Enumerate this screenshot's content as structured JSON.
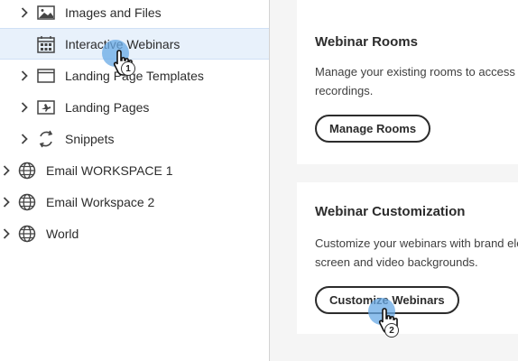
{
  "sidebar": {
    "items": [
      {
        "label": "Images and Files",
        "icon": "image-icon",
        "indent": 1,
        "expandable": true,
        "selected": false
      },
      {
        "label": "Interactive Webinars",
        "icon": "calendar-grid-icon",
        "indent": 1,
        "expandable": false,
        "selected": true
      },
      {
        "label": "Landing Page Templates",
        "icon": "template-icon",
        "indent": 1,
        "expandable": true,
        "selected": false
      },
      {
        "label": "Landing Pages",
        "icon": "landing-page-icon",
        "indent": 1,
        "expandable": true,
        "selected": false
      },
      {
        "label": "Snippets",
        "icon": "snippets-icon",
        "indent": 1,
        "expandable": true,
        "selected": false
      },
      {
        "label": "Email WORKSPACE 1",
        "icon": "globe-icon",
        "indent": 0,
        "expandable": true,
        "selected": false
      },
      {
        "label": "Email Workspace 2",
        "icon": "globe-icon",
        "indent": 0,
        "expandable": true,
        "selected": false
      },
      {
        "label": "World",
        "icon": "globe-icon",
        "indent": 0,
        "expandable": true,
        "selected": false
      }
    ]
  },
  "cards": {
    "rooms": {
      "title": "Webinar Rooms",
      "description": "Manage your existing rooms to access d recordings.",
      "button_label": "Manage Rooms"
    },
    "customization": {
      "title": "Webinar Customization",
      "description": "Customize your webinars with brand ele screen and video backgrounds.",
      "button_label": "Customize Webinars"
    }
  },
  "steps": {
    "step1": "1",
    "step2": "2"
  },
  "colors": {
    "selected_row_bg": "#e8f1fb",
    "main_bg": "#f5f5f5",
    "marker": "#68aae6",
    "text": "#2c2c2c"
  }
}
